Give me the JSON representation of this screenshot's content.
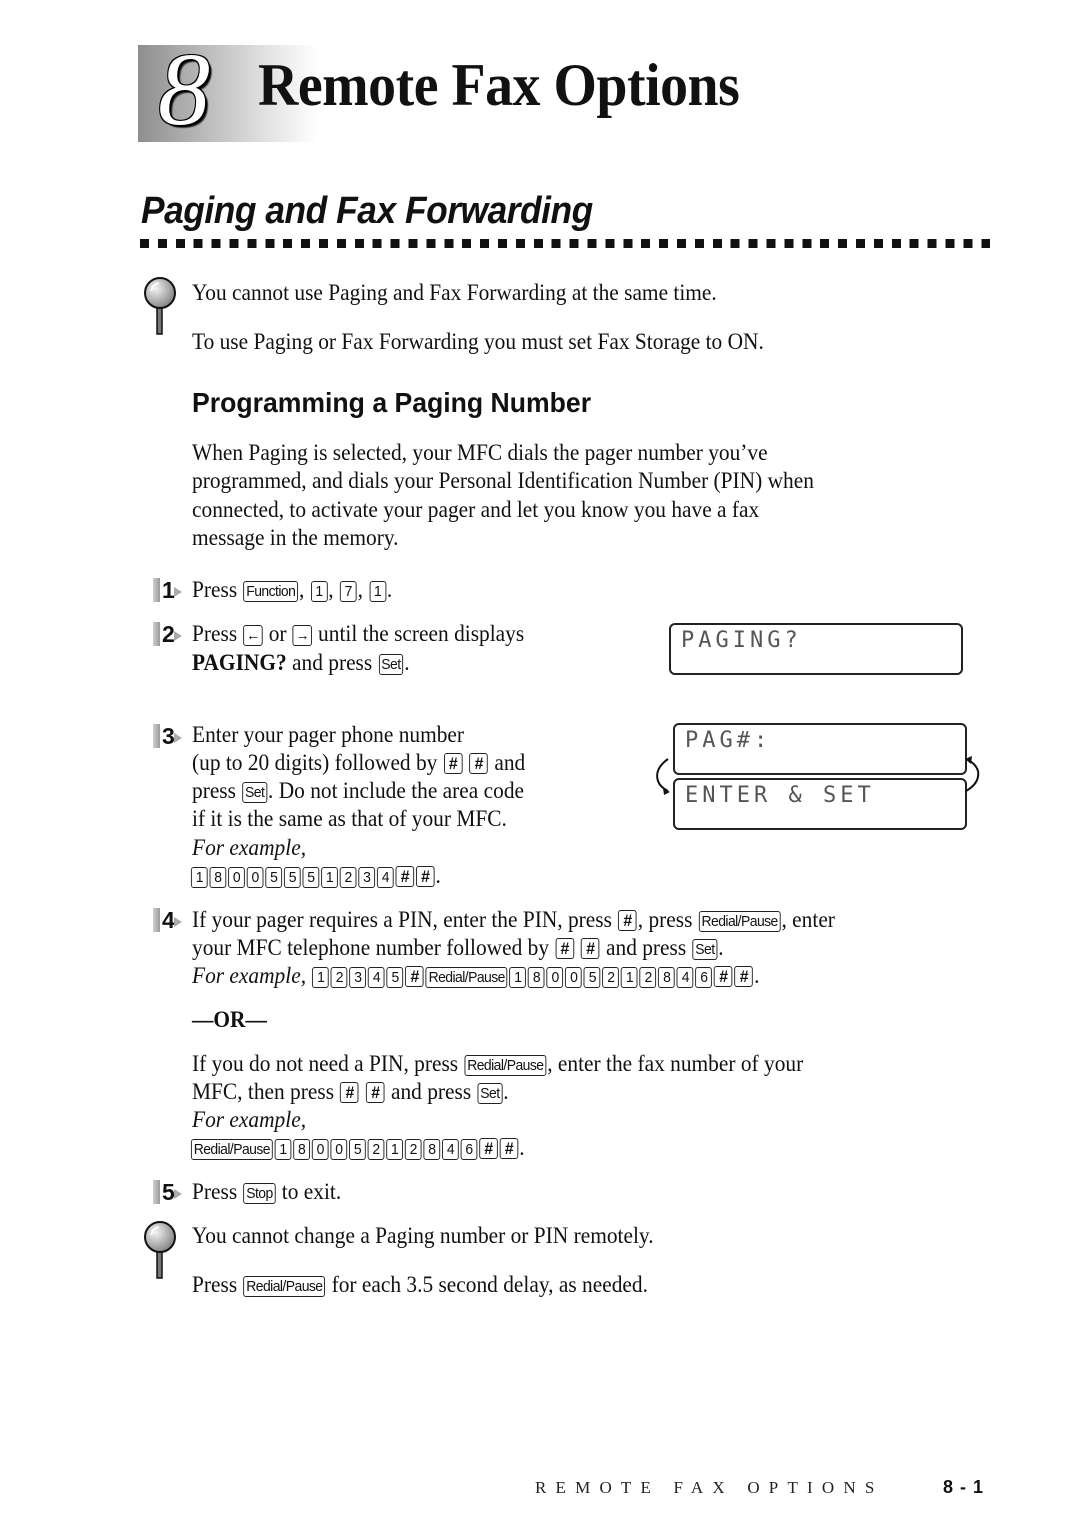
{
  "chapter": {
    "number": "8",
    "title": "Remote Fax Options"
  },
  "section": {
    "title": "Paging and Fax Forwarding"
  },
  "note_top": {
    "icon": "magnifier-note-icon",
    "lines": [
      "You cannot use Paging and Fax Forwarding at the same time.",
      "To use Paging or Fax Forwarding you must set Fax Storage to ON."
    ]
  },
  "subsection": {
    "title": "Programming a Paging Number",
    "intro": [
      "When Paging is selected, your MFC dials the pager number you’ve",
      "programmed, and dials your Personal Identification Number (PIN) when",
      "connected, to activate your pager and let you know you have a fax",
      "message in the memory."
    ]
  },
  "keys": {
    "function": "Function",
    "set": "Set",
    "hash": "#",
    "redial_pause": "Redial/Pause",
    "stop": "Stop",
    "left_arrow": "←",
    "right_arrow": "→"
  },
  "steps": [
    {
      "num": "1",
      "press": "Press",
      "keys_seq": [
        "1",
        "7",
        "1"
      ],
      "sep": ", ",
      "end": "."
    },
    {
      "num": "2",
      "line1_a": "Press",
      "line1_or": "or",
      "line1_b": "until the screen displays",
      "line2_bold": "PAGING?",
      "line2_b": "and press",
      "end": "."
    },
    {
      "num": "3",
      "line1": "Enter your pager phone number",
      "line2_a": "(up to 20 digits) followed by",
      "line2_b": "and",
      "line3_a": "press",
      "line3_b": ". Do not include the area code",
      "line4": "if it is the same as that of your MFC.",
      "example_label": "For example,",
      "example_keys": [
        "1",
        "8",
        "0",
        "0",
        "5",
        "5",
        "5",
        "1",
        "2",
        "3",
        "4"
      ]
    },
    {
      "num": "4",
      "line1_a": "If your pager requires a PIN, enter the PIN, press",
      "line1_b": ", press",
      "line1_c": ", enter",
      "line2_a": "your MFC telephone number followed by",
      "line2_b": "and press",
      "example_label": "For example,",
      "example_pin": [
        "1",
        "2",
        "3",
        "4",
        "5"
      ],
      "example_number": [
        "1",
        "8",
        "0",
        "0",
        "5",
        "2",
        "1",
        "2",
        "8",
        "4",
        "6"
      ],
      "or": "—OR—",
      "alt_line1_a": "If you do not need a PIN, press",
      "alt_line1_b": ", enter the fax number of your",
      "alt_line2_a": "MFC, then press",
      "alt_line2_b": "and press",
      "alt_example_label": "For example,",
      "alt_example_number": [
        "1",
        "8",
        "0",
        "0",
        "5",
        "2",
        "1",
        "2",
        "8",
        "4",
        "6"
      ]
    },
    {
      "num": "5",
      "a": "Press",
      "b": "to exit."
    }
  ],
  "lcd": {
    "screen1": "PAGING?",
    "screen2": "PAG#:",
    "screen3": "ENTER & SET"
  },
  "note_bottom": {
    "icon": "magnifier-note-icon",
    "line1": "You cannot change a Paging number or PIN remotely.",
    "line2_a": "Press",
    "line2_b": "for each 3.5 second delay, as needed."
  },
  "footer": {
    "running_title": "REMOTE FAX OPTIONS",
    "page": "8 - 1"
  }
}
